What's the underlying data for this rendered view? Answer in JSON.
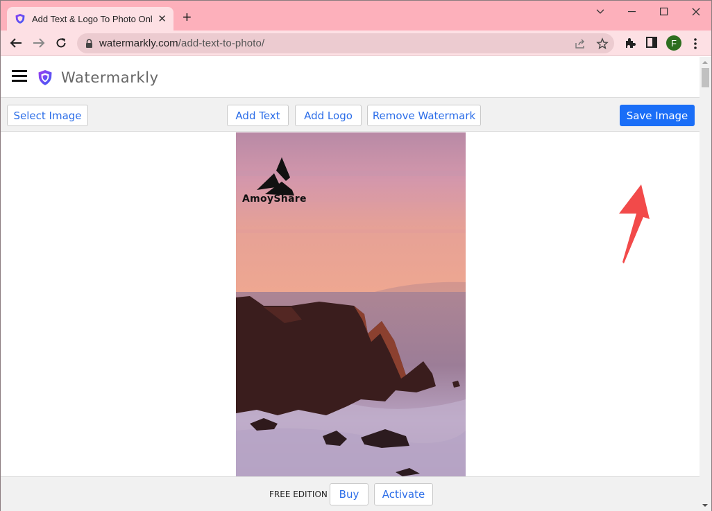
{
  "browser": {
    "tab": {
      "title": "Add Text & Logo To Photo Onl",
      "favicon": "watermarkly-shield-icon"
    },
    "new_tab_label": "+",
    "window_controls": [
      "tab-search",
      "minimize",
      "maximize",
      "close"
    ],
    "url": {
      "host": "watermarkly.com",
      "path": "/add-text-to-photo/"
    },
    "profile_initial": "F",
    "colors": {
      "tabstrip": "#fdb0bb",
      "toolbar": "#fde0e4",
      "avatar": "#2d6e1f"
    }
  },
  "site": {
    "brand_name": "Watermarkly",
    "actions": {
      "select_image": "Select Image",
      "add_text": "Add Text",
      "add_logo": "Add Logo",
      "remove_watermark": "Remove Watermark",
      "save_image": "Save Image"
    },
    "photo": {
      "description": "Pink sunset over sea with dark rocky cliff and waves",
      "watermark_text": "AmoyShare"
    },
    "footer": {
      "edition_label": "FREE EDITION",
      "buy": "Buy",
      "activate": "Activate"
    },
    "colors": {
      "accent": "#1a6ef7",
      "button_text": "#2b6de8",
      "annotation_arrow": "#f24a4a"
    }
  }
}
